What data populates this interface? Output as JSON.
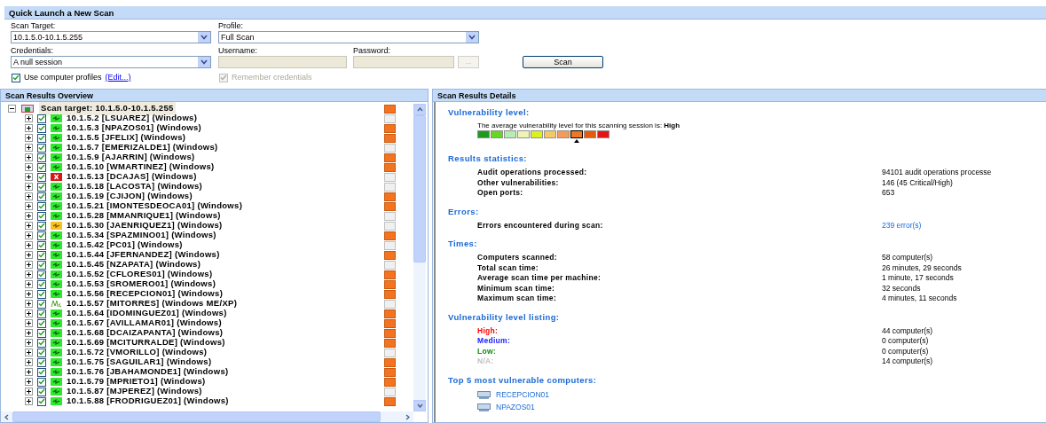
{
  "quick_launch": {
    "title": "Quick Launch a New Scan",
    "scan_target": {
      "label": "Scan Target:",
      "value": "10.1.5.0-10.1.5.255"
    },
    "profile": {
      "label": "Profile:",
      "value": "Full Scan"
    },
    "credentials": {
      "label": "Credentials:",
      "value": "A null session"
    },
    "username": {
      "label": "Username:",
      "disabled": true
    },
    "password": {
      "label": "Password:",
      "disabled": true
    },
    "browse_button": {
      "label": "...",
      "disabled": true
    },
    "scan_button": {
      "label": "Scan"
    },
    "use_profiles": {
      "label": "Use computer profiles",
      "checked": true,
      "link": "(Edit...)"
    },
    "remember": {
      "label": "Remember credentials",
      "checked": true,
      "disabled": true
    }
  },
  "overview": {
    "title": "Scan Results Overview",
    "root": {
      "label": "Scan target: 10.1.5.0-10.1.5.255",
      "expanded": true,
      "high_vulnerability": true,
      "children": [
        {
          "label": "10.1.5.2 [LSUAREZ] (Windows)",
          "checked": true,
          "kind": "ok",
          "high_vulnerability": false
        },
        {
          "label": "10.1.5.3 [NPAZOS01] (Windows)",
          "checked": true,
          "kind": "ok",
          "high_vulnerability": true
        },
        {
          "label": "10.1.5.5 [JFELIX] (Windows)",
          "checked": true,
          "kind": "ok",
          "high_vulnerability": true
        },
        {
          "label": "10.1.5.7 [EMERIZALDE1] (Windows)",
          "checked": true,
          "kind": "ok",
          "high_vulnerability": false
        },
        {
          "label": "10.1.5.9 [AJARRIN] (Windows)",
          "checked": true,
          "kind": "ok",
          "high_vulnerability": true
        },
        {
          "label": "10.1.5.10 [WMARTINEZ] (Windows)",
          "checked": true,
          "kind": "ok",
          "high_vulnerability": true
        },
        {
          "label": "10.1.5.13 [DCAJAS] (Windows)",
          "checked": true,
          "kind": "error",
          "high_vulnerability": false
        },
        {
          "label": "10.1.5.18 [LACOSTA] (Windows)",
          "checked": true,
          "kind": "ok",
          "high_vulnerability": false
        },
        {
          "label": "10.1.5.19 [CJIJON] (Windows)",
          "checked": true,
          "kind": "ok",
          "high_vulnerability": true
        },
        {
          "label": "10.1.5.21 [IMONTESDEOCA01] (Windows)",
          "checked": true,
          "kind": "ok",
          "high_vulnerability": true
        },
        {
          "label": "10.1.5.28 [MMANRIQUE1] (Windows)",
          "checked": true,
          "kind": "ok",
          "high_vulnerability": false
        },
        {
          "label": "10.1.5.30 [JAENRIQUEZ1] (Windows)",
          "checked": true,
          "kind": "warning",
          "high_vulnerability": false
        },
        {
          "label": "10.1.5.34 [SPAZMINO01] (Windows)",
          "checked": true,
          "kind": "ok",
          "high_vulnerability": true
        },
        {
          "label": "10.1.5.42 [PC01] (Windows)",
          "checked": true,
          "kind": "ok",
          "high_vulnerability": false
        },
        {
          "label": "10.1.5.44 [JFERNANDEZ] (Windows)",
          "checked": true,
          "kind": "ok",
          "high_vulnerability": true
        },
        {
          "label": "10.1.5.45 [NZAPATA] (Windows)",
          "checked": true,
          "kind": "ok",
          "high_vulnerability": false
        },
        {
          "label": "10.1.5.52 [CFLORES01] (Windows)",
          "checked": true,
          "kind": "ok",
          "high_vulnerability": true
        },
        {
          "label": "10.1.5.53 [SROMERO01] (Windows)",
          "checked": true,
          "kind": "ok",
          "high_vulnerability": true
        },
        {
          "label": "10.1.5.56 [RECEPCION01] (Windows)",
          "checked": true,
          "kind": "ok",
          "high_vulnerability": true
        },
        {
          "label": "10.1.5.57 [MITORRES] (Windows ME/XP)",
          "checked": true,
          "kind": "me",
          "high_vulnerability": false
        },
        {
          "label": "10.1.5.64 [IDOMINGUEZ01] (Windows)",
          "checked": true,
          "kind": "ok",
          "high_vulnerability": true
        },
        {
          "label": "10.1.5.67 [AVILLAMAR01] (Windows)",
          "checked": true,
          "kind": "ok",
          "high_vulnerability": true
        },
        {
          "label": "10.1.5.68 [DCAIZAPANTA] (Windows)",
          "checked": true,
          "kind": "ok",
          "high_vulnerability": true
        },
        {
          "label": "10.1.5.69 [MCITURRALDE] (Windows)",
          "checked": true,
          "kind": "ok",
          "high_vulnerability": true
        },
        {
          "label": "10.1.5.72 [VMORILLO] (Windows)",
          "checked": true,
          "kind": "ok",
          "high_vulnerability": false
        },
        {
          "label": "10.1.5.75 [SAGUILAR1] (Windows)",
          "checked": true,
          "kind": "ok",
          "high_vulnerability": true
        },
        {
          "label": "10.1.5.76 [JBAHAMONDE1] (Windows)",
          "checked": true,
          "kind": "ok",
          "high_vulnerability": true
        },
        {
          "label": "10.1.5.79 [MPRIETO1] (Windows)",
          "checked": true,
          "kind": "ok",
          "high_vulnerability": true
        },
        {
          "label": "10.1.5.87 [MJPEREZ] (Windows)",
          "checked": true,
          "kind": "ok",
          "high_vulnerability": false
        },
        {
          "label": "10.1.5.88 [FRODRIGUEZ01] (Windows)",
          "checked": true,
          "kind": "ok",
          "high_vulnerability": true
        }
      ]
    }
  },
  "details": {
    "title": "Scan Results Details",
    "vulnerability_level": {
      "heading": "Vulnerability level:",
      "text": "The average vulnerability level for this scanning session is: **High**",
      "segments": [
        {
          "color": "#1e9a1e",
          "selected": false
        },
        {
          "color": "#66d61e",
          "selected": false
        },
        {
          "color": "#b4eeb0",
          "selected": false
        },
        {
          "color": "#eef5b4",
          "selected": false
        },
        {
          "color": "#dcf01e",
          "selected": false
        },
        {
          "color": "#f5c864",
          "selected": false
        },
        {
          "color": "#f59a5a",
          "selected": false
        },
        {
          "color": "#f07822",
          "selected": true
        },
        {
          "color": "#e65a0a",
          "selected": false
        },
        {
          "color": "#e61414",
          "selected": false
        }
      ]
    },
    "sections": [
      {
        "heading": "Results statistics:",
        "rows": [
          {
            "label": "Audit operations processed:",
            "value": "94101 audit operations processe"
          },
          {
            "label": "Other vulnerabilities:",
            "value": "146 (45 Critical/High)"
          },
          {
            "label": "Open ports:",
            "value": "653"
          }
        ]
      },
      {
        "heading": "Errors:",
        "rows": [
          {
            "label": "Errors encountered during scan:",
            "value": "239 error(s)",
            "kind": "link"
          }
        ]
      },
      {
        "heading": "Times:",
        "rows": [
          {
            "label": "Computers scanned:",
            "value": "58 computer(s)"
          },
          {
            "label": "Total scan time:",
            "value": "26 minutes, 29 seconds"
          },
          {
            "label": "Average scan time per machine:",
            "value": "1 minute, 17 seconds"
          },
          {
            "label": "Minimum scan time:",
            "value": "32 seconds"
          },
          {
            "label": "Maximum scan time:",
            "value": "4 minutes, 11 seconds"
          }
        ]
      },
      {
        "heading": "Vulnerability level listing:",
        "rows": [
          {
            "label": "High:",
            "value": "44 computer(s)",
            "color": "#ff0000"
          },
          {
            "label": "Medium:",
            "value": "0 computer(s)",
            "color": "#2020ff"
          },
          {
            "label": "Low:",
            "value": "0 computer(s)",
            "color": "#109010"
          },
          {
            "label": "N/A:",
            "value": "14 computer(s)",
            "color": "#c0c0c0"
          }
        ]
      }
    ],
    "top5": {
      "heading": "Top 5 most vulnerable computers:",
      "items": [
        "RECEPCION01",
        "NPAZOS01"
      ]
    }
  }
}
